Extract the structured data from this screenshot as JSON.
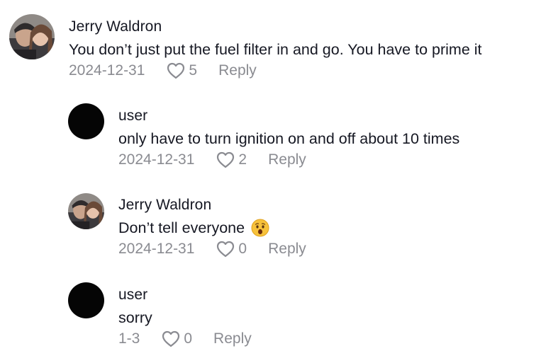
{
  "comments": [
    {
      "username": "Jerry Waldron",
      "text": "You don’t just put the fuel filter in and go. You have to prime it",
      "date": "2024-12-31",
      "likes": "5",
      "reply_label": "Reply",
      "avatar": "photo-avatar"
    },
    {
      "username": "user",
      "text": "only have to turn ignition on and off about 10 times",
      "date": "2024-12-31",
      "likes": "2",
      "reply_label": "Reply",
      "avatar": "black-avatar"
    },
    {
      "username": "Jerry Waldron",
      "text": "Don’t tell everyone",
      "emoji": "hushed-face-emoji",
      "date": "2024-12-31",
      "likes": "0",
      "reply_label": "Reply",
      "avatar": "photo-avatar"
    },
    {
      "username": "user",
      "text": "sorry",
      "date": "1-3",
      "likes": "0",
      "reply_label": "Reply",
      "avatar": "black-avatar"
    }
  ],
  "colors": {
    "text": "#161823",
    "meta": "#8a8b91",
    "avatar_black": "#050505"
  }
}
